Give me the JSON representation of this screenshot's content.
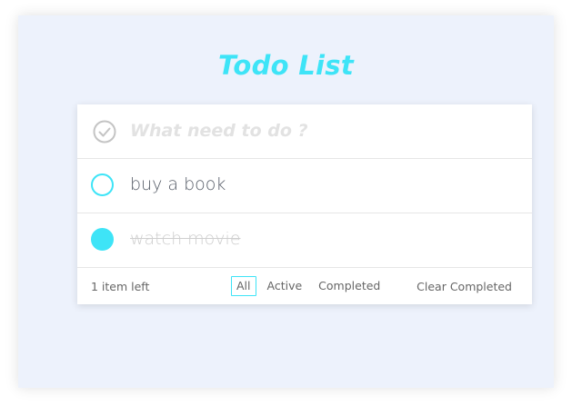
{
  "app": {
    "title": "Todo List",
    "accent_color": "#3ee4f7",
    "background_color": "#edf2fc"
  },
  "input": {
    "placeholder": "What need to do ?",
    "value": "",
    "icon": "check-circle-icon"
  },
  "todos": [
    {
      "text": "buy a book",
      "completed": false
    },
    {
      "text": "watch movie",
      "completed": true
    }
  ],
  "footer": {
    "count_text": "1 item left",
    "filters": [
      {
        "label": "All",
        "selected": true
      },
      {
        "label": "Active",
        "selected": false
      },
      {
        "label": "Completed",
        "selected": false
      }
    ],
    "clear_label": "Clear Completed"
  }
}
